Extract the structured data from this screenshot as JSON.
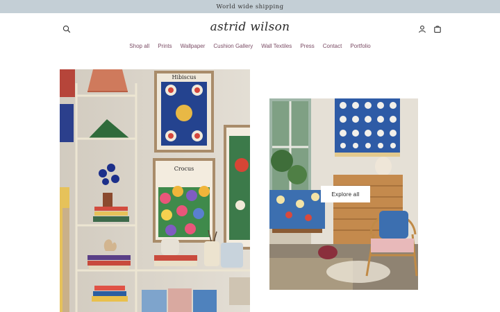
{
  "announcement": {
    "text": "World wide shipping"
  },
  "header": {
    "logo": "astrid wilson",
    "icons": {
      "search": "search-icon",
      "account": "account-icon",
      "cart": "cart-icon"
    }
  },
  "nav": {
    "items": [
      {
        "label": "Shop all"
      },
      {
        "label": "Prints"
      },
      {
        "label": "Wallpaper"
      },
      {
        "label": "Cushion Gallery"
      },
      {
        "label": "Wall Textiles"
      },
      {
        "label": "Press"
      },
      {
        "label": "Contact"
      },
      {
        "label": "Portfolio"
      }
    ]
  },
  "hero": {
    "left_image": {
      "print_top_title": "Hibiscus",
      "print_bottom_title": "Crocus"
    },
    "explore_button": "Explore all"
  },
  "colors": {
    "announcement_bg": "#c4cfd6",
    "nav_link": "#7a4b64",
    "page_bg": "#ffffff"
  }
}
